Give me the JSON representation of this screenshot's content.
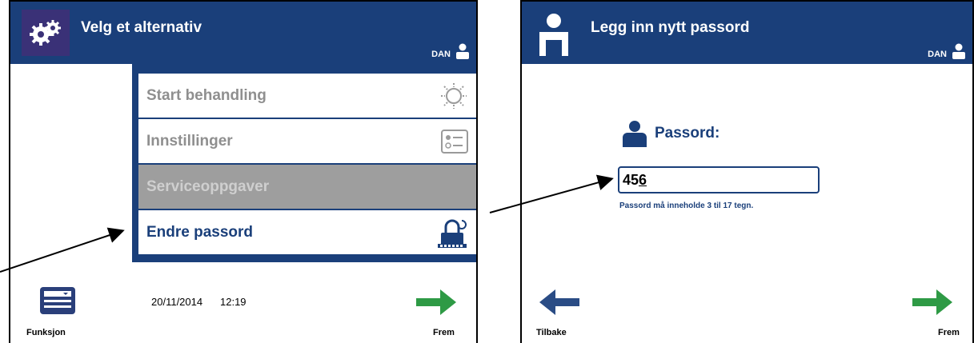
{
  "left_screen": {
    "header_title": "Velg et alternativ",
    "user": "DAN",
    "menu": [
      {
        "label": "Start behandling",
        "icon": "sun-icon",
        "state": "disabled"
      },
      {
        "label": "Innstillinger",
        "icon": "settings-list-icon",
        "state": "disabled"
      },
      {
        "label": "Serviceoppgaver",
        "icon": "",
        "state": "grayed"
      },
      {
        "label": "Endre passord",
        "icon": "padlock-icon",
        "state": "active"
      }
    ],
    "date": "20/11/2014",
    "time": "12:19",
    "function_label": "Funksjon",
    "next_label": "Frem"
  },
  "right_screen": {
    "header_title": "Legg inn nytt passord",
    "user": "DAN",
    "password_label": "Passord:",
    "password_value_plain": "45",
    "password_value_cursor": "6",
    "password_hint": "Passord må inneholde 3 til 17 tegn.",
    "back_label": "Tilbake",
    "next_label": "Frem"
  },
  "colors": {
    "header": "#1a3f7a",
    "accent_green": "#2e9a45",
    "back_arrow": "#2a4c85"
  }
}
